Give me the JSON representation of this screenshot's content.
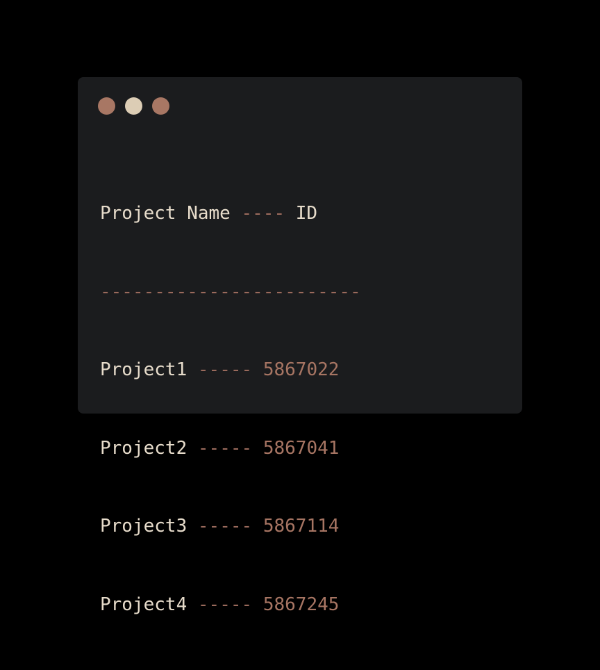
{
  "window": {
    "controls": [
      {
        "name": "close",
        "color": "#a87764"
      },
      {
        "name": "minimize",
        "color": "#dccdb5"
      },
      {
        "name": "maximize",
        "color": "#a87764"
      }
    ]
  },
  "header": {
    "name": "Project Name",
    "separator": "----",
    "id": "ID"
  },
  "divider": "------------------------",
  "rows": [
    {
      "name": "Project1",
      "separator": "-----",
      "id": "5867022"
    },
    {
      "name": "Project2",
      "separator": "-----",
      "id": "5867041"
    },
    {
      "name": "Project3",
      "separator": "-----",
      "id": "5867114"
    },
    {
      "name": "Project4",
      "separator": "-----",
      "id": "5867245"
    }
  ],
  "colors": {
    "background": "#000000",
    "window": "#1b1c1e",
    "text": "#e7dccb",
    "dash": "#9a6a5c",
    "number": "#a77563"
  }
}
